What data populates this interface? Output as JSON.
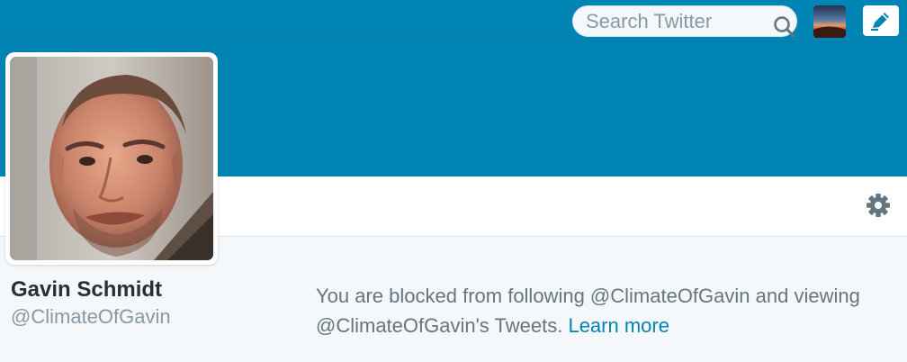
{
  "search": {
    "placeholder": "Search Twitter"
  },
  "icons": {
    "search": "search-icon",
    "compose": "compose-tweet-icon",
    "settings": "gear-icon"
  },
  "colors": {
    "brand": "#0084b4",
    "link": "#0084b4",
    "background": "#f5f8fa"
  },
  "profile": {
    "name": "Gavin Schmidt",
    "handle": "@ClimateOfGavin"
  },
  "blocked_notice": {
    "text": "You are blocked from following @ClimateOfGavin and viewing @ClimateOfGavin's Tweets.",
    "link_label": "Learn more"
  }
}
